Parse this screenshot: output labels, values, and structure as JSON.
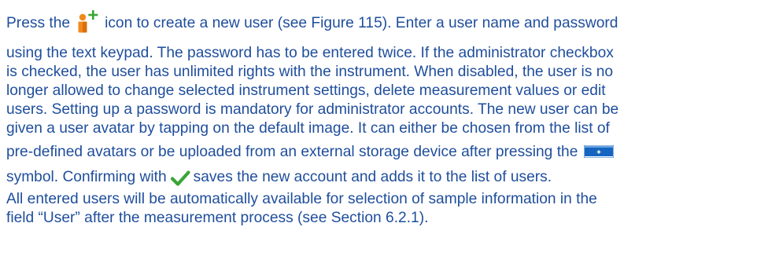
{
  "paragraph1": {
    "l1_before": "Press the",
    "l1_after": "icon to create a new user (see Figure 115). Enter a user name and password",
    "l2": "using the text keypad. The password has to be entered twice. If the administrator checkbox",
    "l3": "is checked, the user has unlimited rights with the instrument. When disabled, the user is no",
    "l4": "longer allowed to change selected instrument settings, delete measurement values or edit",
    "l5": "users. Setting up a password is mandatory for administrator accounts. The new user can be",
    "l6": "given a user avatar by tapping on the default image. It can either be chosen from the list of",
    "l7_before": "pre-defined avatars or be uploaded from an external storage device after pressing the",
    "l8_before": "symbol. Confirming with",
    "l8_after": "saves the new account and adds it to the list of users."
  },
  "paragraph2": {
    "l1": "All entered users will be automatically available for selection of sample information in the",
    "l2": "field “User” after the measurement process (see Section 6.2.1)."
  },
  "icons": {
    "add_user": "add-user-icon",
    "add_bar": "add-bar-icon",
    "confirm": "check-icon"
  },
  "colors": {
    "text": "#1f4e9c",
    "add_user_orange": "#f08a1c",
    "add_user_plus": "#3aa535",
    "bar_blue": "#1565c0",
    "check_green": "#3aa535"
  }
}
